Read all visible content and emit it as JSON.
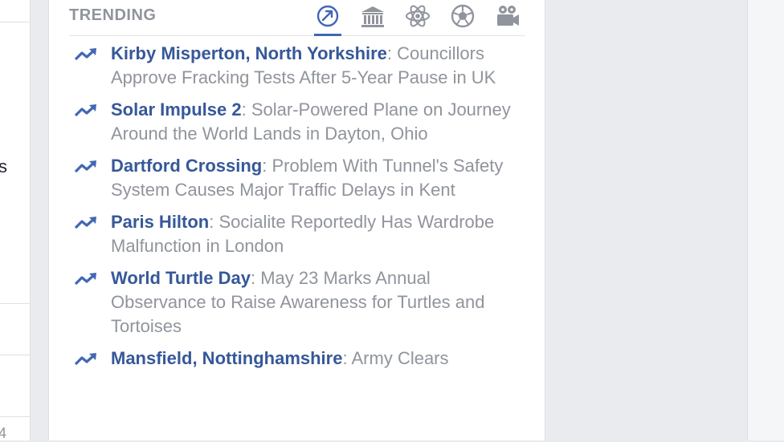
{
  "left_fragments": [
    "s",
    "4"
  ],
  "trending": {
    "title": "TRENDING",
    "tabs": [
      {
        "icon": "trending-icon",
        "active": true
      },
      {
        "icon": "politics-icon",
        "active": false
      },
      {
        "icon": "science-icon",
        "active": false
      },
      {
        "icon": "sports-icon",
        "active": false
      },
      {
        "icon": "entertainment-icon",
        "active": false
      }
    ],
    "accent_color": "#4267b2",
    "topic_color": "#365899",
    "headline_color": "#90949c",
    "items": [
      {
        "topic": "Kirby Misperton, North Yorkshire",
        "headline": "Councillors Approve Fracking Tests After 5-Year Pause in UK"
      },
      {
        "topic": "Solar Impulse 2",
        "headline": "Solar-Powered Plane on Journey Around the World Lands in Dayton, Ohio"
      },
      {
        "topic": "Dartford Crossing",
        "headline": "Problem With Tunnel's Safety System Causes Major Traffic Delays in Kent"
      },
      {
        "topic": "Paris Hilton",
        "headline": "Socialite Reportedly Has Wardrobe Malfunction in London"
      },
      {
        "topic": "World Turtle Day",
        "headline": "May 23 Marks Annual Observance to Raise Awareness for Turtles and Tortoises"
      },
      {
        "topic": "Mansfield, Nottinghamshire",
        "headline": "Army Clears"
      }
    ]
  }
}
